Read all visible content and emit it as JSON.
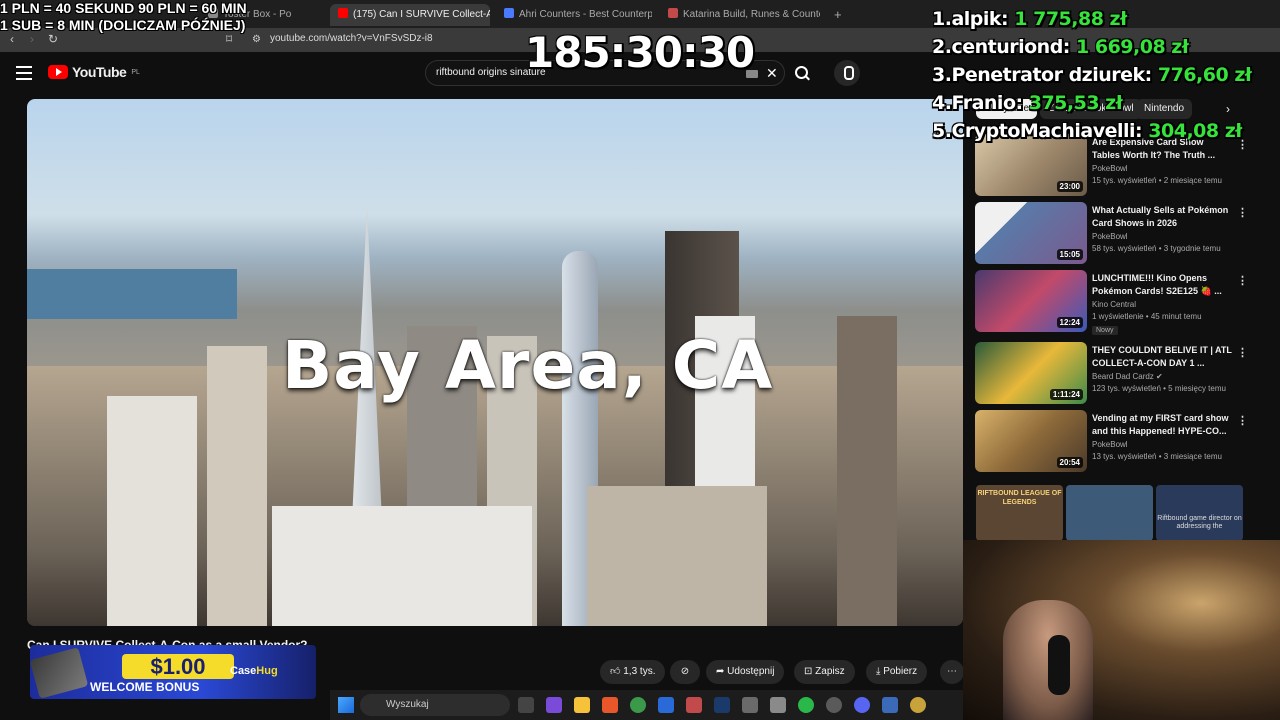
{
  "browser": {
    "tabs": [
      {
        "label": "Toster Box - Po",
        "color": "#888888"
      },
      {
        "label": "(175) Can I SURVIVE Collect-A",
        "color": "#ff0000",
        "active": true
      },
      {
        "label": "Ahri Counters - Best Counterpicks fo",
        "color": "#4a7bff"
      },
      {
        "label": "Katarina Build, Runes & Counters Gu",
        "color": "#c24a4a"
      }
    ],
    "new_tab_label": "+",
    "url": "youtube.com/watch?v=VnFSvSDz-i8"
  },
  "youtube": {
    "logo_text": "YouTube",
    "region": "PL",
    "search_value": "riftbound origins sinature",
    "chips": [
      {
        "label": "Wszystkie",
        "selected": true
      },
      {
        "label": "Z kanału PokeBowl"
      },
      {
        "label": "Nintendo"
      }
    ],
    "video": {
      "overlay_text": "Bay Area, CA",
      "title": "Can I SURVIVE Collect-A-Con as a small Vendor?",
      "likes": "1,3 tys.",
      "share_label": "Udostępnij",
      "save_label": "Zapisz",
      "download_label": "Pobierz"
    },
    "recommendations": [
      {
        "title": "Are Expensive Card Show Tables Worth It? The Truth ...",
        "channel": "PokeBowl",
        "meta": "15 tys. wyświetleń • 2 miesiące temu",
        "duration": "23:00",
        "thumb_color": "#a18b6e"
      },
      {
        "title": "What Actually Sells at Pokémon Card Shows in 2026",
        "channel": "PokeBowl",
        "meta": "58 tys. wyświetleń • 3 tygodnie temu",
        "duration": "15:05",
        "thumb_color": "#5a7aa8"
      },
      {
        "title": "LUNCHTIME!!! Kino Opens Pokémon Cards! S2E125 🍓 ...",
        "channel": "Kino Central",
        "meta": "1 wyświetlenie • 45 minut temu",
        "duration": "12:24",
        "badge": "Nowy",
        "thumb_color": "#6c4d8e"
      },
      {
        "title": "THEY COULDNT BELIVE IT | ATL COLLECT-A-CON DAY 1 ...",
        "channel": "Beard Dad Cardz",
        "meta": "123 tys. wyświetleń • 5 miesięcy temu",
        "duration": "1:11:24",
        "thumb_color": "#3d8a4a"
      },
      {
        "title": "Vending at my FIRST card show and this Happened! HYPE-CO...",
        "channel": "PokeBowl",
        "meta": "13 tys. wyświetleń • 3 miesiące temu",
        "duration": "20:54",
        "thumb_color": "#8e6a3a"
      }
    ],
    "shorts": [
      {
        "label": "RIFTBOUND LEAGUE OF LEGENDS",
        "color": "#5a4632"
      },
      {
        "label": "",
        "color": "#3d5a78"
      },
      {
        "label": "Riftbound game director on addressing the",
        "color": "#2a3a5a"
      }
    ]
  },
  "overlays": {
    "rules": [
      "1 PLN =  40 SEKUND 90 PLN = 60 MIN",
      "1 SUB = 8 MIN (DOLICZAM PÓŹNIEJ)"
    ],
    "timer": "185:30:30",
    "leaderboard": [
      {
        "rank": "1.",
        "name": "alpik:",
        "amount": "1 775,88 zł"
      },
      {
        "rank": "2.",
        "name": "centuriond:",
        "amount": "1 669,08 zł"
      },
      {
        "rank": "3.",
        "name": "Penetrator dziurek:",
        "amount": "776,60 zł"
      },
      {
        "rank": "4.",
        "name": "Franio:",
        "amount": "375,53 zł"
      },
      {
        "rank": "5.",
        "name": "CryptoMachiavelli:",
        "amount": "304,08 zł"
      }
    ]
  },
  "promo": {
    "amount": "$1.00",
    "text": "WELCOME BONUS",
    "brand_a": "Case",
    "brand_b": "Hug"
  },
  "taskbar": {
    "search_placeholder": "Wyszukaj"
  }
}
